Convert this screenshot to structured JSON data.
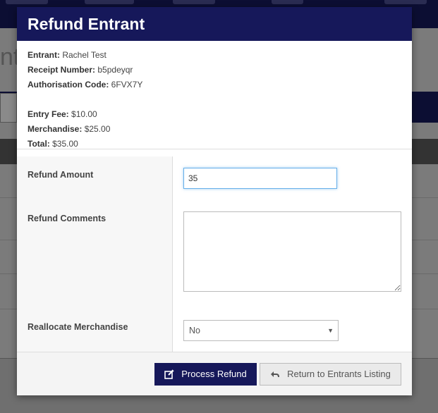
{
  "background": {
    "title_fragment": "nt"
  },
  "modal": {
    "title": "Refund Entrant",
    "info": {
      "entrant_label": "Entrant:",
      "entrant_value": "Rachel Test",
      "receipt_label": "Receipt Number:",
      "receipt_value": "b5pdeyqr",
      "auth_label": "Authorisation Code:",
      "auth_value": "6FVX7Y",
      "entry_fee_label": "Entry Fee:",
      "entry_fee_value": "$10.00",
      "merch_label": "Merchandise:",
      "merch_value": "$25.00",
      "total_label": "Total:",
      "total_value": "$35.00"
    },
    "form": {
      "refund_amount_label": "Refund Amount",
      "refund_amount_value": "35",
      "refund_comments_label": "Refund Comments",
      "refund_comments_value": "",
      "reallocate_label": "Reallocate Merchandise",
      "reallocate_selected": "No"
    },
    "footer": {
      "process_label": "Process Refund",
      "process_icon": "edit-icon",
      "return_label": "Return to Entrants Listing",
      "return_icon": "reply-arrow-icon"
    }
  },
  "colors": {
    "header_bg": "#16185a",
    "focus_border": "#66afe9"
  }
}
